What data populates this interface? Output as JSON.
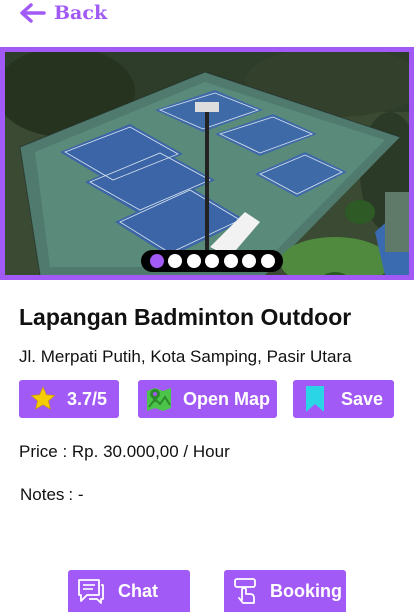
{
  "header": {
    "back_label": "Back"
  },
  "gallery": {
    "slide_count": 7,
    "active_index": 0
  },
  "venue": {
    "name": "Lapangan Badminton Outdoor",
    "address": "Jl. Merpati Putih, Kota Samping, Pasir Utara",
    "rating_label": "3.7/5",
    "map_label": "Open Map",
    "save_label": "Save",
    "price_label": "Price : Rp. 30.000,00 / Hour",
    "notes_label": "Notes",
    "notes_value": ": -"
  },
  "actions": {
    "chat_label": "Chat",
    "booking_label": "Booking"
  },
  "colors": {
    "accent": "#a25af6",
    "star": "#f5cc00",
    "map_icon": "#4cc44a",
    "bookmark": "#2ad6e6"
  },
  "icons": [
    "arrow-left-icon",
    "star-icon",
    "map-icon",
    "bookmark-icon",
    "chat-icon",
    "booking-icon"
  ]
}
